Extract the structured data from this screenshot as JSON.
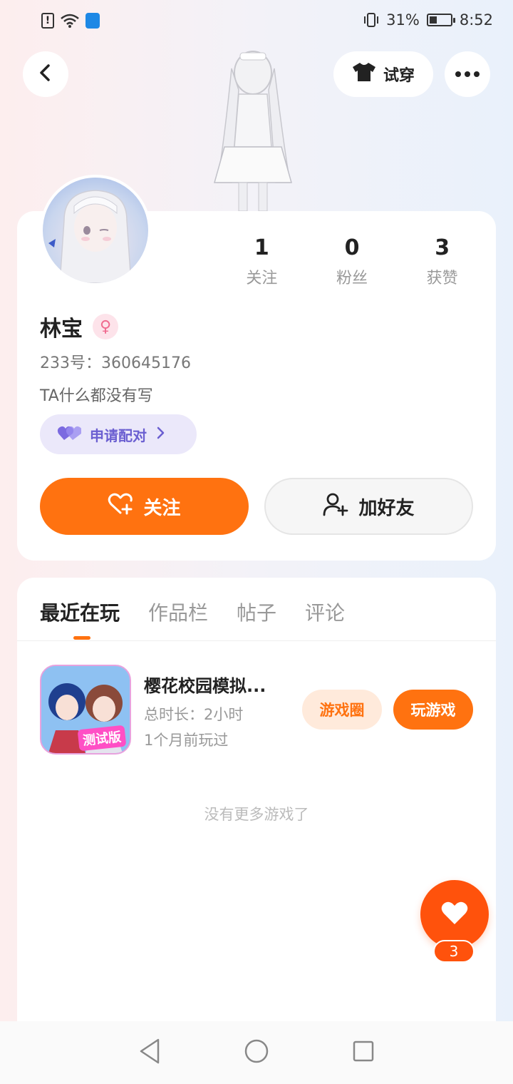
{
  "status_bar": {
    "battery": "31%",
    "time": "8:52"
  },
  "header": {
    "try_on_label": "试穿"
  },
  "profile": {
    "stats": [
      {
        "value": "1",
        "label": "关注"
      },
      {
        "value": "0",
        "label": "粉丝"
      },
      {
        "value": "3",
        "label": "获赞"
      }
    ],
    "name": "林宝",
    "uid": "233号：360645176",
    "bio": "TA什么都没有写",
    "pair_label": "申请配对",
    "follow_label": "关注",
    "add_friend_label": "加好友"
  },
  "tabs": [
    {
      "label": "最近在玩",
      "active": true
    },
    {
      "label": "作品栏",
      "active": false
    },
    {
      "label": "帖子",
      "active": false
    },
    {
      "label": "评论",
      "active": false
    }
  ],
  "games": [
    {
      "title": "樱花校园模拟...",
      "duration": "总时长：2小时",
      "last_played": "1个月前玩过",
      "badge": "测试版",
      "circle_label": "游戏圈",
      "play_label": "玩游戏"
    }
  ],
  "empty_text": "没有更多游戏了",
  "likes": {
    "count": "3"
  },
  "colors": {
    "accent": "#ff7210",
    "like": "#ff520c",
    "pair": "#6b5fd1"
  }
}
